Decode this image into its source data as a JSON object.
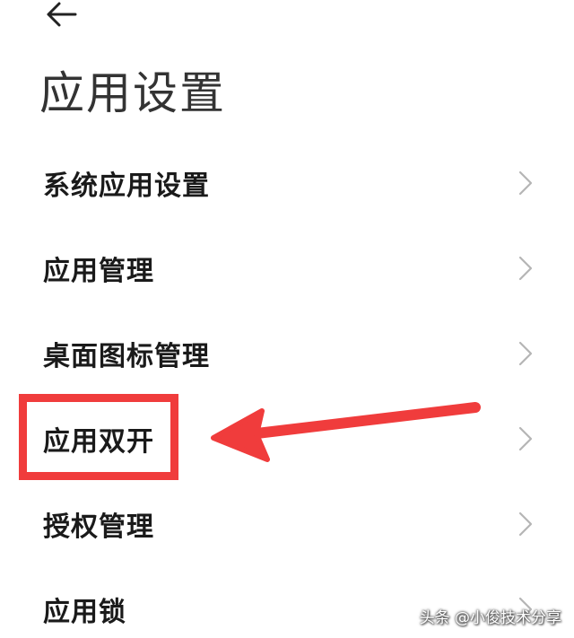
{
  "header": {
    "back_icon": "arrow-left-icon",
    "title": "应用设置"
  },
  "menu": {
    "items": [
      {
        "label": "系统应用设置"
      },
      {
        "label": "应用管理"
      },
      {
        "label": "桌面图标管理"
      },
      {
        "label": "应用双开",
        "highlighted": true
      },
      {
        "label": "授权管理"
      },
      {
        "label": "应用锁"
      }
    ],
    "chevron_icon": "chevron-right-icon"
  },
  "annotation": {
    "color": "#f03c3c",
    "arrow_icon": "arrow-left-icon"
  },
  "watermark": {
    "text": "头条 @小俊技术分享"
  }
}
